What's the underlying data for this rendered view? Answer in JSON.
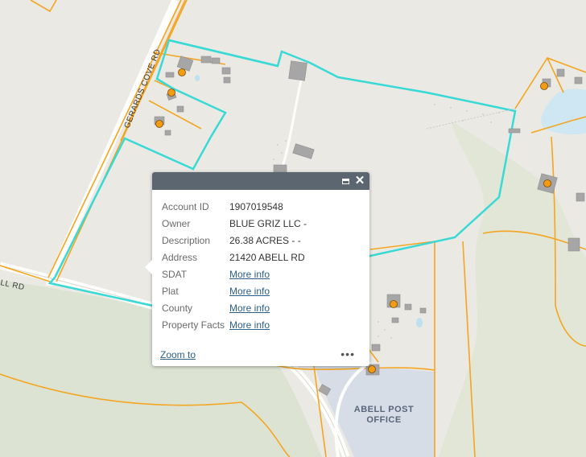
{
  "map": {
    "road_labels": [
      "GERARDS COVE RD",
      "LL RD"
    ],
    "place_labels": [
      "ABELL POST",
      "OFFICE"
    ],
    "colors": {
      "parcel_boundary": "#f4a521",
      "selected_parcel": "#39d9d6",
      "building": "#a6a6a6",
      "point_marker": "#f39c12",
      "water": "#cfe7f2",
      "forest": "#dde3d3",
      "post_office_area": "#d7dde6"
    }
  },
  "popup": {
    "maximize_icon": "maximize-icon",
    "close_icon": "close-icon",
    "fields": [
      {
        "label": "Account ID",
        "value": "1907019548",
        "link": false
      },
      {
        "label": "Owner",
        "value": "BLUE GRIZ LLC -",
        "link": false
      },
      {
        "label": "Description",
        "value": "26.38 ACRES - -",
        "link": false
      },
      {
        "label": "Address",
        "value": "21420 ABELL RD",
        "link": false
      },
      {
        "label": "SDAT",
        "value": "More info",
        "link": true
      },
      {
        "label": "Plat",
        "value": "More info",
        "link": true
      },
      {
        "label": "County",
        "value": "More info",
        "link": true
      },
      {
        "label": "Property Facts",
        "value": "More info",
        "link": true
      }
    ],
    "zoom_label": "Zoom to",
    "more_label": "•••"
  }
}
